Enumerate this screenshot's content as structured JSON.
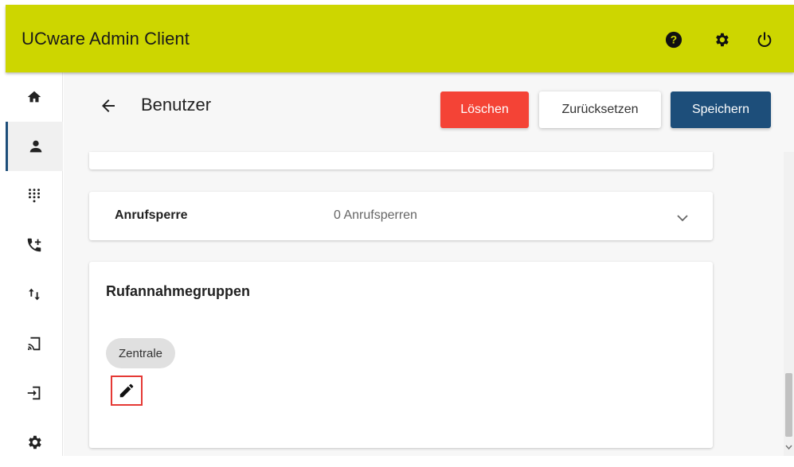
{
  "app": {
    "title": "UCware Admin Client",
    "accent_color": "#cdd600",
    "top_icons": [
      "help-icon",
      "settings-icon",
      "power-icon"
    ]
  },
  "sidebar": {
    "items": [
      {
        "icon": "home-icon",
        "active": false
      },
      {
        "icon": "user-icon",
        "active": true
      },
      {
        "icon": "dialpad-icon",
        "active": false
      },
      {
        "icon": "phone-forward-icon",
        "active": false
      },
      {
        "icon": "swap-vertical-icon",
        "active": false
      },
      {
        "icon": "cast-device-icon",
        "active": false
      },
      {
        "icon": "login-icon",
        "active": false
      },
      {
        "icon": "settings-icon",
        "active": false
      }
    ]
  },
  "header": {
    "title": "Benutzer",
    "buttons": {
      "delete": "Löschen",
      "reset": "Zurücksetzen",
      "save": "Speichern"
    },
    "colors": {
      "delete": "#f44336",
      "save": "#1d4e7a"
    }
  },
  "sections": {
    "anrufsperre": {
      "label": "Anrufsperre",
      "value": "0 Anrufsperren"
    },
    "rufannahmegruppen": {
      "title": "Rufannahmegruppen",
      "chips": [
        "Zentrale"
      ]
    }
  }
}
